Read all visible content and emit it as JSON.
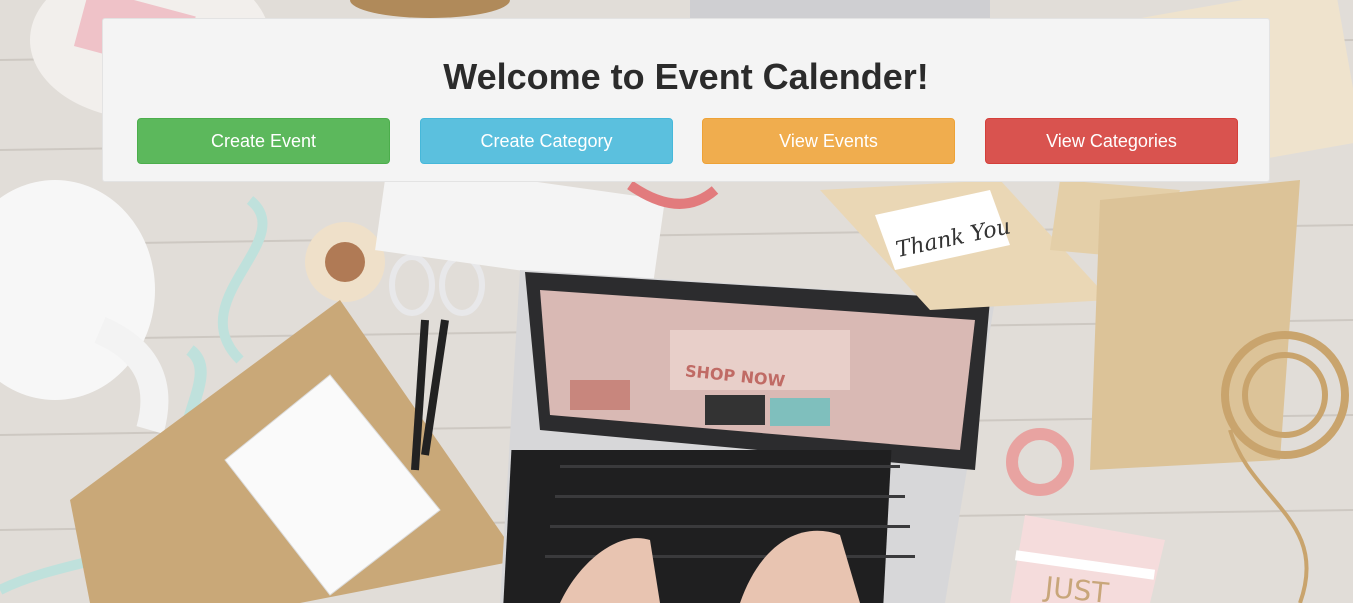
{
  "page": {
    "title": "Welcome to Event Calender!"
  },
  "actions": {
    "create_event": "Create Event",
    "create_category": "Create Category",
    "view_events": "View Events",
    "view_categories": "View Categories"
  },
  "background": {
    "card_text": "Thank You",
    "notebook_text": "JUST",
    "screen_text": "SHOP NOW"
  },
  "colors": {
    "success": "#5cb85c",
    "info": "#5bc0de",
    "warning": "#f0ad4e",
    "danger": "#d9534f"
  }
}
